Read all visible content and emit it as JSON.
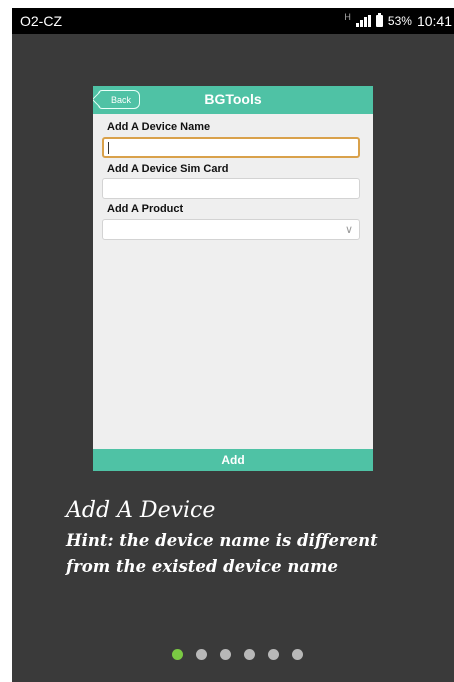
{
  "status_bar": {
    "carrier": "O2-CZ",
    "network_type": "H",
    "battery_percent": "53%",
    "time": "10:41"
  },
  "app_screen": {
    "back_label": "Back",
    "title": "BGTools",
    "fields": [
      {
        "label": "Add A Device Name",
        "value": ""
      },
      {
        "label": "Add A Device Sim Card",
        "value": ""
      },
      {
        "label": "Add A Product",
        "value": ""
      }
    ],
    "add_label": "Add"
  },
  "hint": {
    "title": "Add A Device",
    "text": "Hint: the device name is different from the existed device name"
  },
  "pager": {
    "total_pages": 6,
    "current_page": 1
  },
  "colors": {
    "accent": "#4fc2a5",
    "focus_border": "#d9a14b",
    "active_dot": "#7ac943",
    "background": "#3a3a3a"
  }
}
